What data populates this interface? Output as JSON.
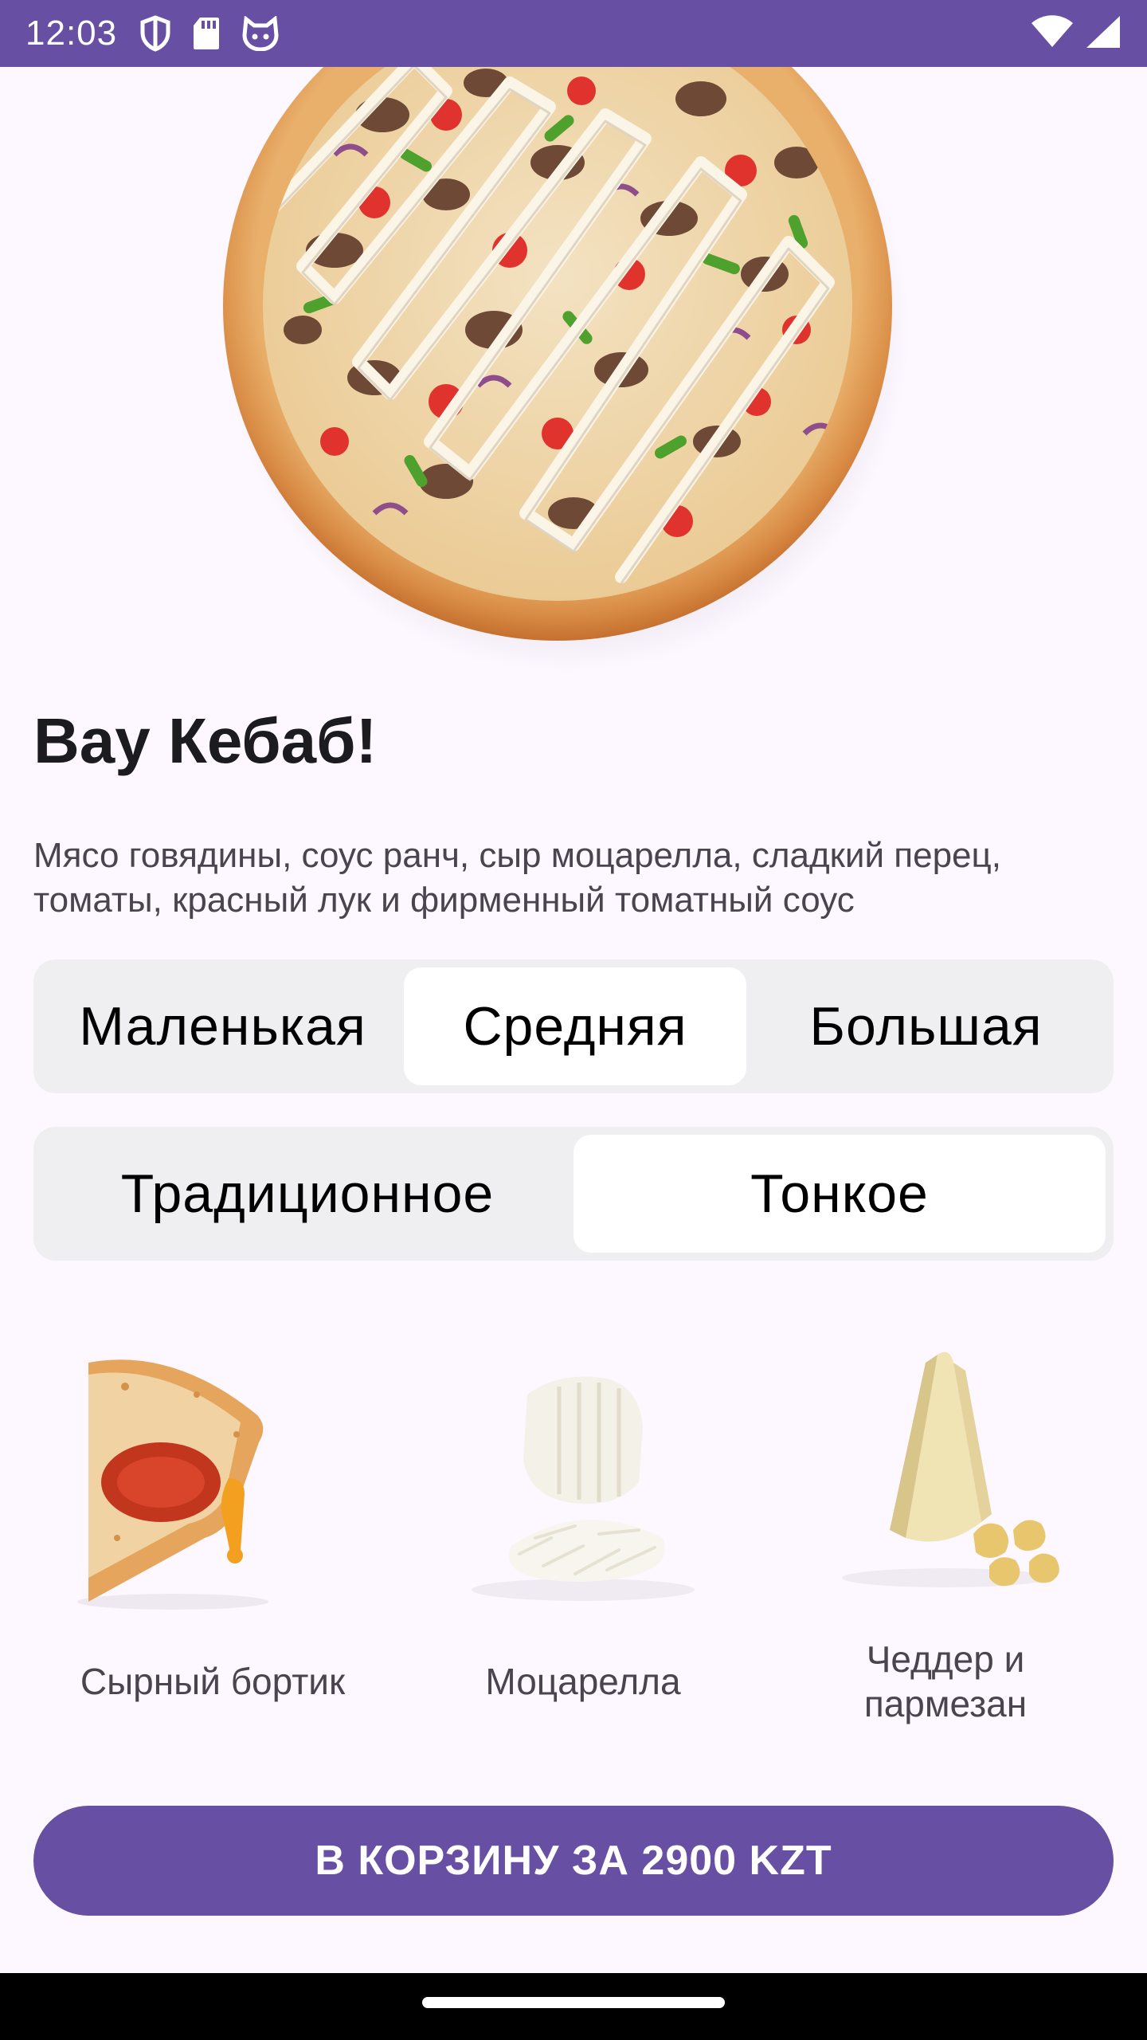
{
  "status_bar": {
    "time": "12:03",
    "left_icons": [
      "shield-icon",
      "sd-card-icon",
      "cat-face-icon"
    ],
    "right_icons": [
      "wifi-icon",
      "signal-icon"
    ],
    "color": "#6750A4"
  },
  "product": {
    "image": "pizza-image",
    "title": "Вау Кебаб!",
    "description": "Мясо говядины, соус ранч, сыр моцарелла, сладкий перец, томаты, красный лук и фирменный томатный соус"
  },
  "size_selector": {
    "options": [
      "Маленькая",
      "Средняя",
      "Большая"
    ],
    "selected": "Средняя"
  },
  "dough_selector": {
    "options": [
      "Традиционное",
      "Тонкое"
    ],
    "selected": "Тонкое"
  },
  "toppings": [
    {
      "label": "Сырный бортик",
      "image": "cheese-crust-image"
    },
    {
      "label": "Моцарелла",
      "image": "mozzarella-image"
    },
    {
      "label": "Чеддер и пармезан",
      "image": "cheddar-parmesan-image"
    }
  ],
  "cta": {
    "label": "В КОРЗИНУ ЗА 2900 KZT"
  },
  "colors": {
    "primary": "#6750A4",
    "background": "#FDF7FF",
    "segment_track": "#EFEFF2"
  }
}
